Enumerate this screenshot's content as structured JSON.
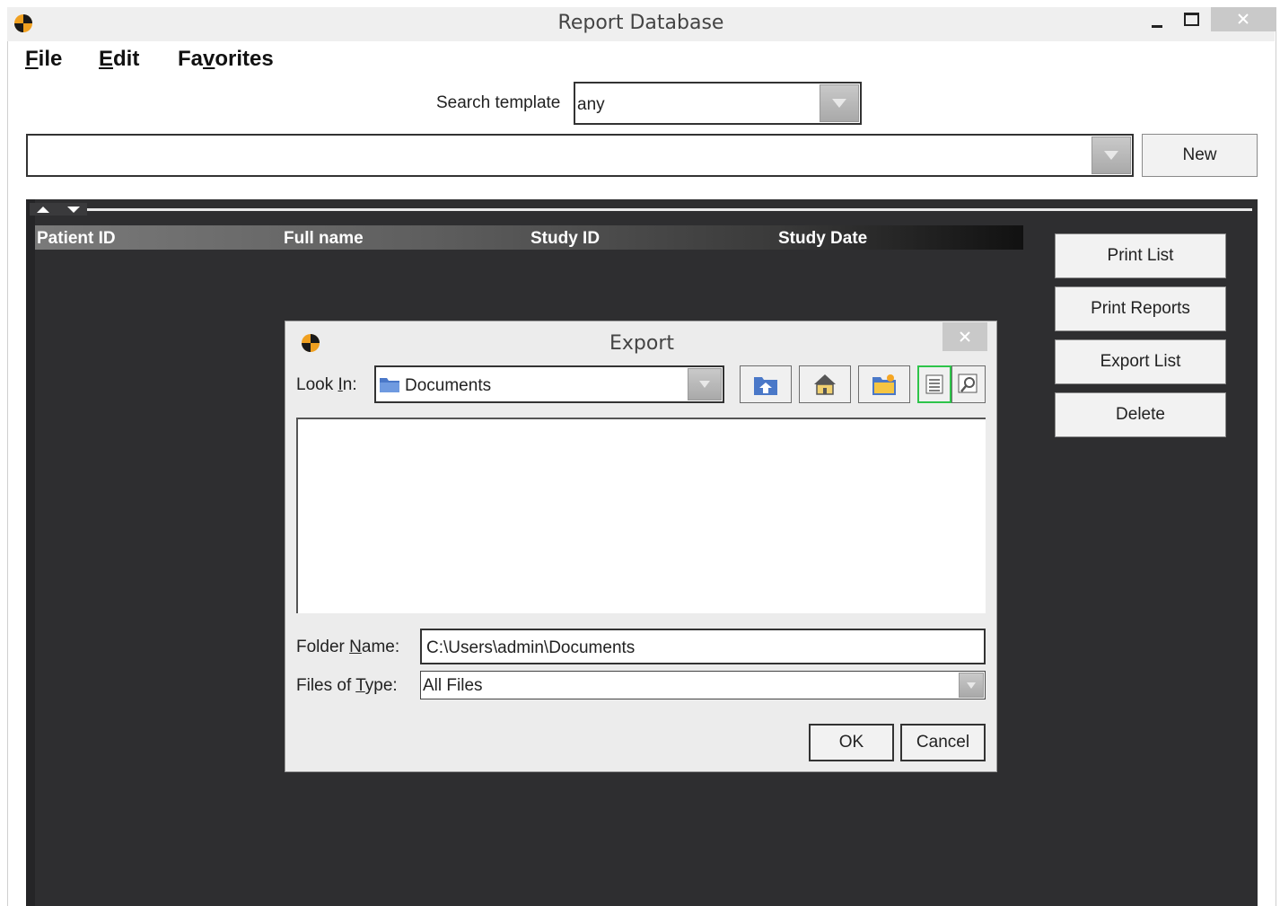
{
  "window": {
    "title": "Report Database",
    "controls": {
      "minimize_icon": "minimize-icon",
      "maximize_icon": "maximize-icon",
      "close_icon": "close-icon"
    }
  },
  "menu": {
    "items": [
      {
        "label_first": "F",
        "label_rest": "ile"
      },
      {
        "label_first": "E",
        "label_rest": "dit"
      },
      {
        "label_pre": "Fa",
        "label_mnemonic": "v",
        "label_post": "orites"
      }
    ]
  },
  "search": {
    "label": "Search template",
    "value": "any"
  },
  "query": {
    "value": "",
    "new_label": "New"
  },
  "table": {
    "columns": [
      "Patient ID",
      "Full name",
      "Study ID",
      "Study Date"
    ],
    "rows": []
  },
  "side_buttons": {
    "print_list": "Print List",
    "print_reports": "Print Reports",
    "export_list": "Export List",
    "delete": "Delete"
  },
  "dialog": {
    "title": "Export",
    "look_in_pre": "Look ",
    "look_in_mnemonic": "I",
    "look_in_post": "n:",
    "look_in_value": "Documents",
    "folder_name_pre": "Folder ",
    "folder_name_mnemonic": "N",
    "folder_name_post": "ame:",
    "folder_name_value": "C:\\Users\\admin\\Documents",
    "files_type_pre": "Files of ",
    "files_type_mnemonic": "T",
    "files_type_post": "ype:",
    "files_type_value": "All Files",
    "ok_label": "OK",
    "cancel_label": "Cancel"
  },
  "colors": {
    "panel_bg": "#2e2e30",
    "accent_green": "#2ec44a"
  }
}
